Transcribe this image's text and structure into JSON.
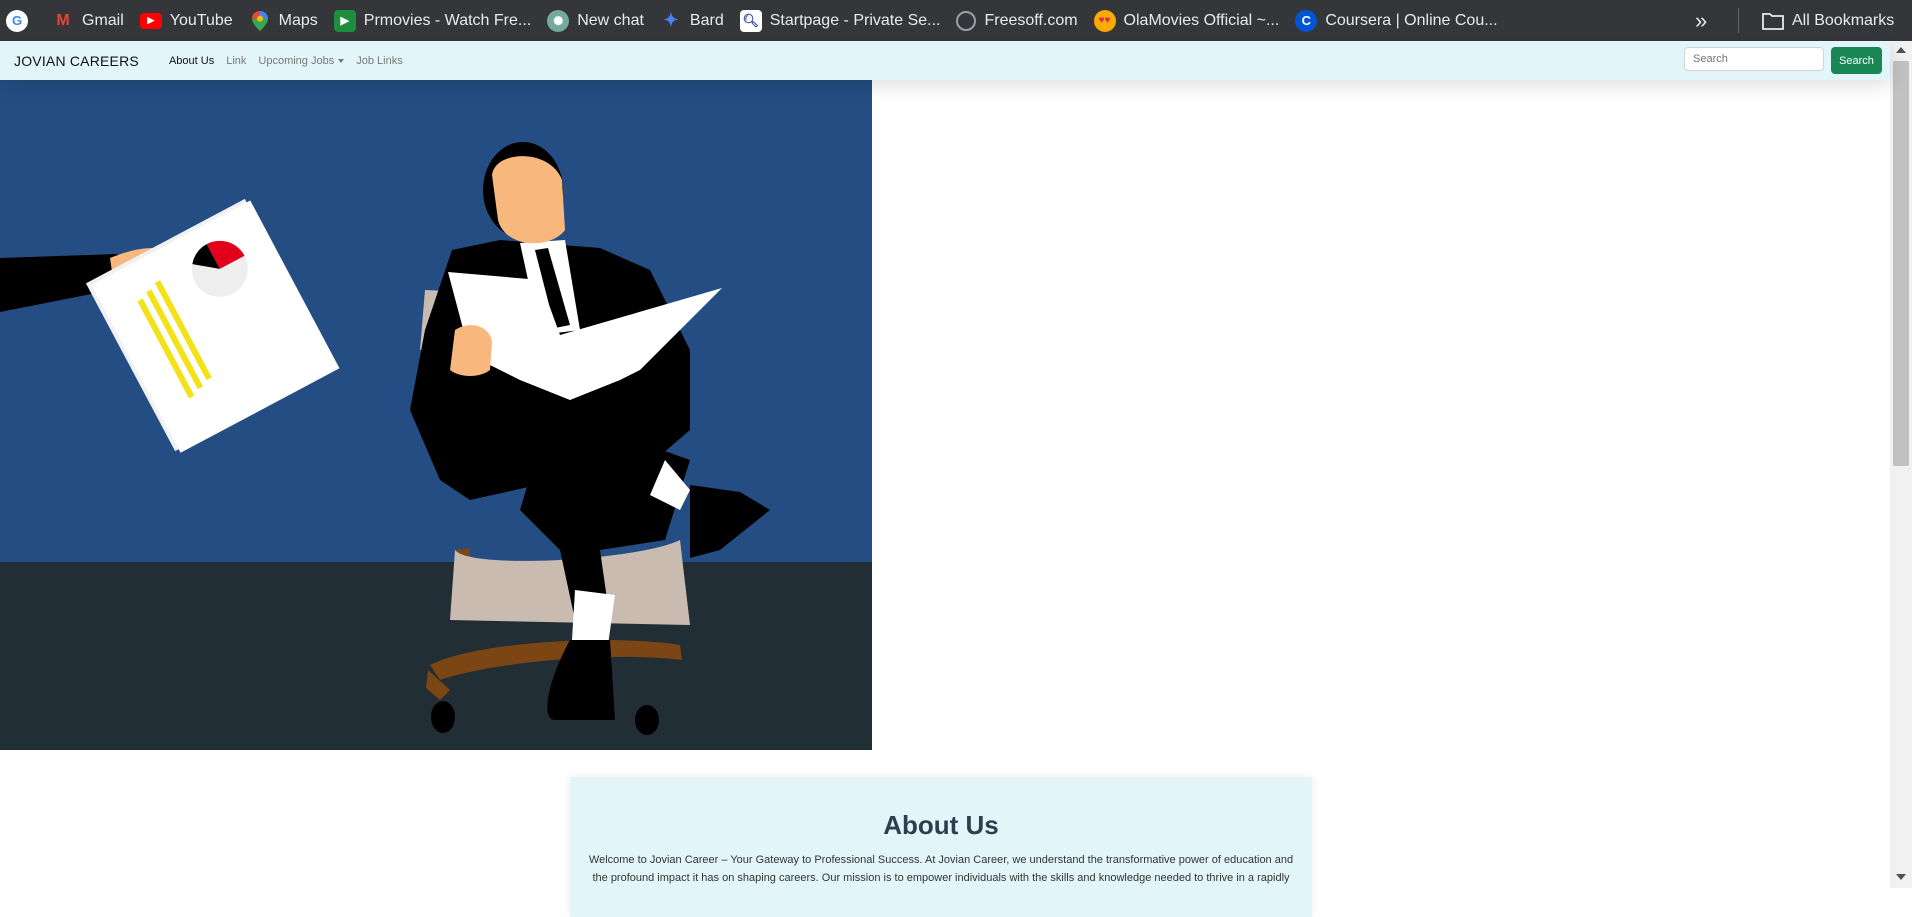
{
  "bookmarks": {
    "items": [
      {
        "label": "",
        "icon": "google-icon",
        "color": "#ffffff"
      },
      {
        "label": "Gmail",
        "icon": "gmail-icon",
        "color": "#ea4335"
      },
      {
        "label": "YouTube",
        "icon": "youtube-icon",
        "color": "#ff0000"
      },
      {
        "label": "Maps",
        "icon": "maps-icon",
        "color": "#34a853"
      },
      {
        "label": "Prmovies - Watch Fre...",
        "icon": "play-icon",
        "color": "#1e8e3e"
      },
      {
        "label": "New chat",
        "icon": "chatgpt-icon",
        "color": "#74aa9c"
      },
      {
        "label": "Bard",
        "icon": "bard-icon",
        "color": "#4285f4"
      },
      {
        "label": "Startpage - Private Se...",
        "icon": "startpage-icon",
        "color": "#ffffff"
      },
      {
        "label": "Freesoff.com",
        "icon": "freesoff-icon",
        "color": "#9aa0a6"
      },
      {
        "label": "OlaMovies Official ~...",
        "icon": "heart-eyes-icon",
        "color": "#f9ab00"
      },
      {
        "label": "Coursera | Online Cou...",
        "icon": "coursera-icon",
        "color": "#0056d2"
      }
    ],
    "more_glyph": "»",
    "all_bookmarks": "All Bookmarks"
  },
  "navbar": {
    "brand": "JOVIAN CAREERS",
    "links": {
      "about": "About Us",
      "link": "Link",
      "upcoming": "Upcoming Jobs",
      "job_links": "Job Links"
    },
    "search_placeholder": "Search",
    "search_button": "Search"
  },
  "about": {
    "title": "About Us",
    "text": "Welcome to Jovian Career – Your Gateway to Professional Success. At Jovian Career, we understand the transformative power of education and the profound impact it has on shaping careers. Our mission is to empower individuals with the skills and knowledge needed to thrive in a rapidly"
  },
  "colors": {
    "navbar_bg": "#e2f6fa",
    "search_button": "#198754",
    "hero_wall": "#244d83",
    "hero_floor": "#212e35"
  }
}
